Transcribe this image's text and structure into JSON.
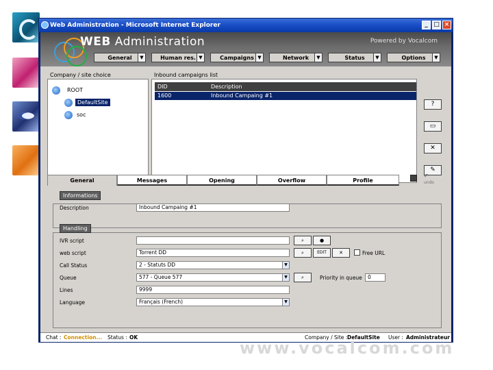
{
  "window": {
    "title": "Web Administration - Microsoft Internet Explorer",
    "controls": {
      "minimize": "_",
      "maximize": "□",
      "close": "×"
    }
  },
  "header": {
    "app_title_bold": "WEB",
    "app_title_rest": " Administration",
    "powered_by": "Powered by Vocalcom"
  },
  "nav": [
    {
      "label": "General"
    },
    {
      "label": "Human res."
    },
    {
      "label": "Campaigns"
    },
    {
      "label": "Network"
    },
    {
      "label": "Status"
    },
    {
      "label": "Options"
    }
  ],
  "tree": {
    "title": "Company / site choice",
    "items": [
      {
        "label": "ROOT"
      },
      {
        "label": "DefaultSite"
      },
      {
        "label": "soc"
      }
    ]
  },
  "campaigns": {
    "title": "Inbound campaigns list",
    "columns": [
      "DID",
      "Description"
    ],
    "rows": [
      {
        "did": "1600",
        "description": "Inbound Campaing #1"
      }
    ]
  },
  "side_buttons": [
    "?",
    "",
    "",
    ""
  ],
  "tabs": [
    {
      "label": "General",
      "active": true
    },
    {
      "label": "Messages",
      "active": false
    },
    {
      "label": "Opening",
      "active": false
    },
    {
      "label": "Overflow",
      "active": false
    },
    {
      "label": "Profile",
      "active": false
    }
  ],
  "toolbar": {
    "undo_label": "undo"
  },
  "information": {
    "title": "Informations",
    "description_label": "Description",
    "description_value": "Inbound Campaing #1"
  },
  "handling": {
    "title": "Handling",
    "ivr_script_label": "IVR script",
    "ivr_script_value": "",
    "web_script_label": "web script",
    "web_script_value": "Torrent DD",
    "edit_label": "EDIT",
    "free_url_label": "Free URL",
    "call_status_label": "Call Status",
    "call_status_value": "2 - Statuts DD",
    "queue_label": "Queue",
    "queue_value": "577 - Queue 577",
    "priority_label": "Priority in queue",
    "priority_value": "0",
    "lines_label": "Lines",
    "lines_value": "9999",
    "language_label": "Language",
    "language_value": "Français (French)"
  },
  "status": {
    "chat_label": "Chat :",
    "chat_value": "Connection...",
    "status_label": "Status :",
    "status_value": "OK",
    "company_label": "Company / Site :",
    "company_value": "DefaultSite",
    "user_label": "User :",
    "user_value": "Administrateur"
  },
  "watermark": "www.vocalcom.com"
}
